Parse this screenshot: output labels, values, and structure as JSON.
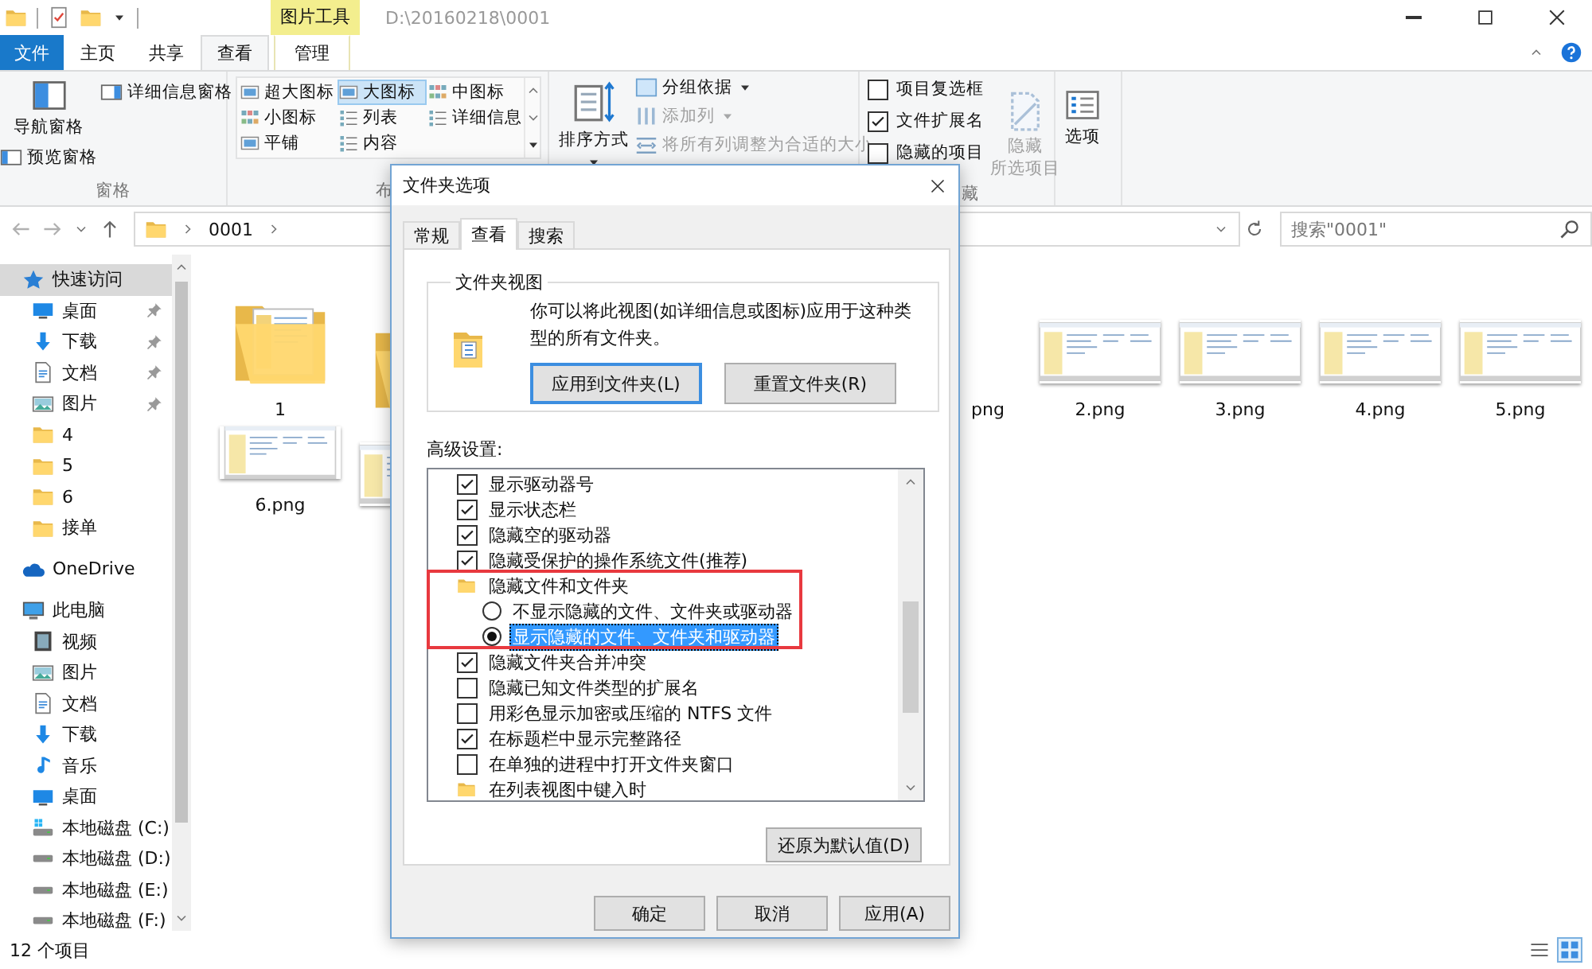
{
  "window": {
    "context_tab_group": "图片工具",
    "title": "D:\\20160218\\0001"
  },
  "ribbon_tabs": [
    {
      "label": "文件",
      "kind": "file",
      "selected": false
    },
    {
      "label": "主页",
      "kind": "normal",
      "selected": false
    },
    {
      "label": "共享",
      "kind": "normal",
      "selected": false
    },
    {
      "label": "查看",
      "kind": "normal",
      "selected": true
    },
    {
      "label": "管理",
      "kind": "context",
      "selected": false
    }
  ],
  "ribbon": {
    "panes": {
      "label": "窗格",
      "navigation_pane": "导航窗格",
      "preview_pane": "预览窗格",
      "details_pane": "详细信息窗格"
    },
    "layout": {
      "label": "布",
      "options": [
        {
          "label": "超大图标",
          "selected": false
        },
        {
          "label": "大图标",
          "selected": true
        },
        {
          "label": "中图标",
          "selected": false
        },
        {
          "label": "小图标",
          "selected": false
        },
        {
          "label": "列表",
          "selected": false
        },
        {
          "label": "详细信息",
          "selected": false
        },
        {
          "label": "平铺",
          "selected": false
        },
        {
          "label": "内容",
          "selected": false
        }
      ]
    },
    "current_view": {
      "sort_by": "排序方式",
      "group_by": {
        "label": "分组依据",
        "disabled": false
      },
      "add_columns": {
        "label": "添加列",
        "disabled": true
      },
      "size_columns": {
        "label": "将所有列调整为合适的大小",
        "disabled": true
      }
    },
    "show_hide": {
      "label": "藏",
      "checkboxes": [
        {
          "label": "项目复选框",
          "checked": false
        },
        {
          "label": "文件扩展名",
          "checked": true
        },
        {
          "label": "隐藏的项目",
          "checked": false
        }
      ],
      "hide_selected": {
        "label_lines": [
          "隐藏",
          "所选项目"
        ],
        "disabled": true
      }
    },
    "options": {
      "label": "选项"
    }
  },
  "address_bar": {
    "path": [
      "0001"
    ],
    "search_placeholder": "搜索\"0001\""
  },
  "nav": [
    {
      "label": "快速访问",
      "kind": "star",
      "selected": true,
      "children": [
        {
          "label": "桌面",
          "kind": "desktop",
          "pinned": true,
          "selected": false
        },
        {
          "label": "下载",
          "kind": "download",
          "pinned": true,
          "selected": false
        },
        {
          "label": "文档",
          "kind": "document",
          "pinned": true,
          "selected": false
        },
        {
          "label": "图片",
          "kind": "picture",
          "pinned": true,
          "selected": false
        },
        {
          "label": "4",
          "kind": "folder",
          "pinned": false,
          "selected": false
        },
        {
          "label": "5",
          "kind": "folder",
          "pinned": false,
          "selected": false
        },
        {
          "label": "6",
          "kind": "folder",
          "pinned": false,
          "selected": false
        },
        {
          "label": "接单",
          "kind": "folder",
          "pinned": false,
          "selected": false
        }
      ]
    },
    {
      "label": "OneDrive",
      "kind": "cloud",
      "selected": false
    },
    {
      "label": "此电脑",
      "kind": "pc",
      "selected": false,
      "children": [
        {
          "label": "视频",
          "kind": "video",
          "pinned": false,
          "selected": false
        },
        {
          "label": "图片",
          "kind": "picture",
          "pinned": false,
          "selected": false
        },
        {
          "label": "文档",
          "kind": "document",
          "pinned": false,
          "selected": false
        },
        {
          "label": "下载",
          "kind": "download",
          "pinned": false,
          "selected": false
        },
        {
          "label": "音乐",
          "kind": "music",
          "pinned": false,
          "selected": false
        },
        {
          "label": "桌面",
          "kind": "desktop",
          "pinned": false,
          "selected": false
        },
        {
          "label": "本地磁盘 (C:)",
          "kind": "system_drive",
          "pinned": false,
          "selected": false
        },
        {
          "label": "本地磁盘 (D:)",
          "kind": "drive",
          "pinned": false,
          "selected": false
        },
        {
          "label": "本地磁盘 (E:)",
          "kind": "drive",
          "pinned": false,
          "selected": false
        },
        {
          "label": "本地磁盘 (F:)",
          "kind": "drive",
          "pinned": false,
          "selected": false
        }
      ]
    }
  ],
  "files": [
    {
      "kind": "folder",
      "label": "1"
    },
    {
      "kind": "folder"
    },
    {
      "kind": "clipped_label",
      "label": "png"
    },
    {
      "kind": "image",
      "label": "2.png"
    },
    {
      "kind": "image",
      "label": "3.png"
    },
    {
      "kind": "image",
      "label": "4.png"
    },
    {
      "kind": "image",
      "label": "5.png"
    },
    {
      "kind": "image",
      "label": "6.png"
    },
    {
      "kind": "image"
    }
  ],
  "status_bar": {
    "item_count": "12 个项目",
    "view_buttons": [
      {
        "kind": "details",
        "selected": false
      },
      {
        "kind": "large_icons",
        "selected": true
      }
    ]
  },
  "dialog": {
    "title": "文件夹选项",
    "tabs": [
      {
        "label": "常规",
        "selected": false
      },
      {
        "label": "查看",
        "selected": true
      },
      {
        "label": "搜索",
        "selected": false
      }
    ],
    "folder_views": {
      "title": "文件夹视图",
      "description": "你可以将此视图(如详细信息或图标)应用于这种类型的所有文件夹。",
      "buttons": [
        {
          "label": "应用到文件夹(L)",
          "focused": true
        },
        {
          "label": "重置文件夹(R)",
          "focused": false
        }
      ]
    },
    "advanced": {
      "label": "高级设置:",
      "items": [
        {
          "kind": "check",
          "label": "显示驱动器号",
          "checked": true
        },
        {
          "kind": "check",
          "label": "显示状态栏",
          "checked": true
        },
        {
          "kind": "check",
          "label": "隐藏空的驱动器",
          "checked": true
        },
        {
          "kind": "check",
          "label": "隐藏受保护的操作系统文件(推荐)",
          "checked": true
        },
        {
          "kind": "group",
          "label": "隐藏文件和文件夹",
          "children": [
            {
              "kind": "radio",
              "label": "不显示隐藏的文件、文件夹或驱动器",
              "selected": false
            },
            {
              "kind": "radio",
              "label": "显示隐藏的文件、文件夹和驱动器",
              "selected": true
            }
          ]
        },
        {
          "kind": "check",
          "label": "隐藏文件夹合并冲突",
          "checked": true
        },
        {
          "kind": "check",
          "label": "隐藏已知文件类型的扩展名",
          "checked": false
        },
        {
          "kind": "check",
          "label": "用彩色显示加密或压缩的 NTFS 文件",
          "checked": false
        },
        {
          "kind": "check",
          "label": "在标题栏中显示完整路径",
          "checked": true
        },
        {
          "kind": "check",
          "label": "在单独的进程中打开文件夹窗口",
          "checked": false
        },
        {
          "kind": "group",
          "label": "在列表视图中键入时"
        }
      ]
    },
    "restore_button": "还原为默认值(D)",
    "buttons": [
      "确定",
      "取消",
      "应用(A)"
    ]
  }
}
